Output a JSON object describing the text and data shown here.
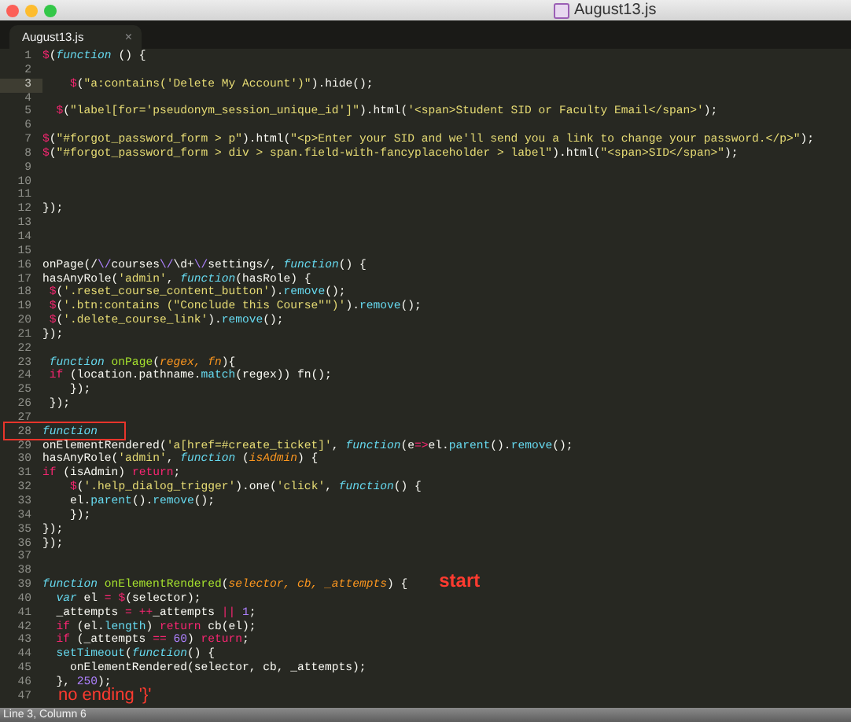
{
  "window": {
    "title": "August13.js"
  },
  "tabs": [
    {
      "label": "August13.js",
      "close": "×",
      "selected": true
    }
  ],
  "lines": [
    {
      "number": "1",
      "current": false,
      "tokens": [
        {
          "kind": "k",
          "text": "$"
        },
        {
          "kind": "t",
          "text": "("
        },
        {
          "kind": "f",
          "text": "function"
        },
        {
          "kind": "t",
          "text": " () {"
        }
      ]
    },
    {
      "number": "2",
      "current": false
    },
    {
      "number": "3",
      "current": true,
      "tokens": [
        {
          "kind": "k",
          "text": "    $"
        },
        {
          "kind": "t",
          "text": "("
        },
        {
          "kind": "s",
          "text": "\"a:contains('Delete My Account')\""
        },
        {
          "kind": "t",
          "text": ").hide();"
        }
      ]
    },
    {
      "number": "4",
      "current": false
    },
    {
      "number": "5",
      "current": false,
      "tokens": [
        {
          "kind": "k",
          "text": "  $"
        },
        {
          "kind": "t",
          "text": "("
        },
        {
          "kind": "s",
          "text": "\"label[for='pseudonym_session_unique_id']\""
        },
        {
          "kind": "t",
          "text": ").html("
        },
        {
          "kind": "s",
          "text": "'<span>Student SID or Faculty Email</span>'"
        },
        {
          "kind": "t",
          "text": ");"
        }
      ]
    },
    {
      "number": "6",
      "current": false
    },
    {
      "number": "7",
      "current": false,
      "tokens": [
        {
          "kind": "k",
          "text": "$"
        },
        {
          "kind": "t",
          "text": "("
        },
        {
          "kind": "s",
          "text": "\"#forgot_password_form > p\""
        },
        {
          "kind": "t",
          "text": ").html("
        },
        {
          "kind": "s",
          "text": "\"<p>Enter your SID and we'll send you a link to change your password.</p>\""
        },
        {
          "kind": "t",
          "text": ");"
        }
      ]
    },
    {
      "number": "8",
      "current": false,
      "tokens": [
        {
          "kind": "k",
          "text": "$"
        },
        {
          "kind": "t",
          "text": "("
        },
        {
          "kind": "s",
          "text": "\"#forgot_password_form > div > span.field-with-fancyplaceholder > label\""
        },
        {
          "kind": "t",
          "text": ").html("
        },
        {
          "kind": "s",
          "text": "\"<span>SID</span>\""
        },
        {
          "kind": "t",
          "text": ");"
        }
      ]
    },
    {
      "number": "9",
      "current": false
    },
    {
      "number": "10",
      "current": false
    },
    {
      "number": "11",
      "current": false
    },
    {
      "number": "12",
      "current": false,
      "tokens": [
        {
          "kind": "t",
          "text": "});"
        }
      ]
    },
    {
      "number": "13",
      "current": false
    },
    {
      "number": "14",
      "current": false
    },
    {
      "number": "15",
      "current": false
    },
    {
      "number": "16",
      "current": false,
      "tokens": [
        {
          "kind": "t",
          "text": "onPage(/"
        },
        {
          "kind": "n",
          "text": "\\/"
        },
        {
          "kind": "t",
          "text": "courses"
        },
        {
          "kind": "n",
          "text": "\\/"
        },
        {
          "kind": "t",
          "text": "\\d+"
        },
        {
          "kind": "n",
          "text": "\\/"
        },
        {
          "kind": "t",
          "text": "settings/, "
        },
        {
          "kind": "f",
          "text": "function"
        },
        {
          "kind": "t",
          "text": "() {"
        }
      ]
    },
    {
      "number": "17",
      "current": false,
      "tokens": [
        {
          "kind": "t",
          "text": "hasAnyRole("
        },
        {
          "kind": "s",
          "text": "'admin'"
        },
        {
          "kind": "t",
          "text": ", "
        },
        {
          "kind": "f",
          "text": "function"
        },
        {
          "kind": "t",
          "text": "(hasRole) {"
        }
      ]
    },
    {
      "number": "18",
      "current": false,
      "tokens": [
        {
          "kind": "k",
          "text": " $"
        },
        {
          "kind": "t",
          "text": "("
        },
        {
          "kind": "s",
          "text": "'.reset_course_content_button'"
        },
        {
          "kind": "t",
          "text": ")."
        },
        {
          "kind": "c",
          "text": "remove"
        },
        {
          "kind": "t",
          "text": "();"
        }
      ]
    },
    {
      "number": "19",
      "current": false,
      "tokens": [
        {
          "kind": "k",
          "text": " $"
        },
        {
          "kind": "t",
          "text": "("
        },
        {
          "kind": "s",
          "text": "'.btn:contains (\"Conclude this Course\"\")'"
        },
        {
          "kind": "t",
          "text": ")."
        },
        {
          "kind": "c",
          "text": "remove"
        },
        {
          "kind": "t",
          "text": "();"
        }
      ]
    },
    {
      "number": "20",
      "current": false,
      "tokens": [
        {
          "kind": "k",
          "text": " $"
        },
        {
          "kind": "t",
          "text": "("
        },
        {
          "kind": "s",
          "text": "'.delete_course_link'"
        },
        {
          "kind": "t",
          "text": ")."
        },
        {
          "kind": "c",
          "text": "remove"
        },
        {
          "kind": "t",
          "text": "();"
        }
      ]
    },
    {
      "number": "21",
      "current": false,
      "tokens": [
        {
          "kind": "t",
          "text": "});"
        }
      ]
    },
    {
      "number": "22",
      "current": false
    },
    {
      "number": "23",
      "current": false,
      "tokens": [
        {
          "kind": "f",
          "text": " function"
        },
        {
          "kind": "g",
          "text": " onPage"
        },
        {
          "kind": "t",
          "text": "("
        },
        {
          "kind": "p",
          "text": "regex, fn"
        },
        {
          "kind": "t",
          "text": "){"
        }
      ]
    },
    {
      "number": "24",
      "current": false,
      "tokens": [
        {
          "kind": "k",
          "text": " if"
        },
        {
          "kind": "t",
          "text": " (location.pathname."
        },
        {
          "kind": "c",
          "text": "match"
        },
        {
          "kind": "t",
          "text": "(regex)) fn();"
        }
      ]
    },
    {
      "number": "25",
      "current": false,
      "tokens": [
        {
          "kind": "t",
          "text": "    });"
        }
      ]
    },
    {
      "number": "26",
      "current": false,
      "tokens": [
        {
          "kind": "t",
          "text": " });"
        }
      ]
    },
    {
      "number": "27",
      "current": false
    },
    {
      "number": "28",
      "current": false,
      "boxed": true,
      "tokens": [
        {
          "kind": "f",
          "text": "function"
        }
      ]
    },
    {
      "number": "29",
      "current": false,
      "tokens": [
        {
          "kind": "t",
          "text": "onElementRendered("
        },
        {
          "kind": "s",
          "text": "'a[href=#create_ticket]'"
        },
        {
          "kind": "t",
          "text": ", "
        },
        {
          "kind": "f",
          "text": "function"
        },
        {
          "kind": "t",
          "text": "(e"
        },
        {
          "kind": "k",
          "text": "=>"
        },
        {
          "kind": "t",
          "text": "el."
        },
        {
          "kind": "c",
          "text": "parent"
        },
        {
          "kind": "t",
          "text": "()."
        },
        {
          "kind": "c",
          "text": "remove"
        },
        {
          "kind": "t",
          "text": "();"
        }
      ]
    },
    {
      "number": "30",
      "current": false,
      "tokens": [
        {
          "kind": "t",
          "text": "hasAnyRole("
        },
        {
          "kind": "s",
          "text": "'admin'"
        },
        {
          "kind": "t",
          "text": ", "
        },
        {
          "kind": "f",
          "text": "function"
        },
        {
          "kind": "t",
          "text": " ("
        },
        {
          "kind": "p",
          "text": "isAdmin"
        },
        {
          "kind": "t",
          "text": ") {"
        }
      ]
    },
    {
      "number": "31",
      "current": false,
      "tokens": [
        {
          "kind": "k",
          "text": "if"
        },
        {
          "kind": "t",
          "text": " (isAdmin) "
        },
        {
          "kind": "k",
          "text": "return"
        },
        {
          "kind": "t",
          "text": ";"
        }
      ]
    },
    {
      "number": "32",
      "current": false,
      "tokens": [
        {
          "kind": "k",
          "text": "    $"
        },
        {
          "kind": "t",
          "text": "("
        },
        {
          "kind": "s",
          "text": "'.help_dialog_trigger'"
        },
        {
          "kind": "t",
          "text": ").one("
        },
        {
          "kind": "s",
          "text": "'click'"
        },
        {
          "kind": "t",
          "text": ", "
        },
        {
          "kind": "f",
          "text": "function"
        },
        {
          "kind": "t",
          "text": "() {"
        }
      ]
    },
    {
      "number": "33",
      "current": false,
      "tokens": [
        {
          "kind": "t",
          "text": "    el."
        },
        {
          "kind": "c",
          "text": "parent"
        },
        {
          "kind": "t",
          "text": "()."
        },
        {
          "kind": "c",
          "text": "remove"
        },
        {
          "kind": "t",
          "text": "();"
        }
      ]
    },
    {
      "number": "34",
      "current": false,
      "tokens": [
        {
          "kind": "t",
          "text": "    });"
        }
      ]
    },
    {
      "number": "35",
      "current": false,
      "tokens": [
        {
          "kind": "t",
          "text": "});"
        }
      ]
    },
    {
      "number": "36",
      "current": false,
      "tokens": [
        {
          "kind": "t",
          "text": "});"
        }
      ]
    },
    {
      "number": "37",
      "current": false
    },
    {
      "number": "38",
      "current": false
    },
    {
      "number": "39",
      "current": false,
      "note": "start",
      "tokens": [
        {
          "kind": "f",
          "text": "function"
        },
        {
          "kind": "g",
          "text": " onElementRendered"
        },
        {
          "kind": "t",
          "text": "("
        },
        {
          "kind": "p",
          "text": "selector, cb, _attempts"
        },
        {
          "kind": "t",
          "text": ") {"
        }
      ]
    },
    {
      "number": "40",
      "current": false,
      "tokens": [
        {
          "kind": "f",
          "text": "  var"
        },
        {
          "kind": "t",
          "text": " el "
        },
        {
          "kind": "k",
          "text": "="
        },
        {
          "kind": "k",
          "text": " $"
        },
        {
          "kind": "t",
          "text": "(selector);"
        }
      ]
    },
    {
      "number": "41",
      "current": false,
      "tokens": [
        {
          "kind": "t",
          "text": "  _attempts "
        },
        {
          "kind": "k",
          "text": "="
        },
        {
          "kind": "k",
          "text": " ++"
        },
        {
          "kind": "t",
          "text": "_attempts "
        },
        {
          "kind": "k",
          "text": "||"
        },
        {
          "kind": "n",
          "text": " 1"
        },
        {
          "kind": "t",
          "text": ";"
        }
      ]
    },
    {
      "number": "42",
      "current": false,
      "tokens": [
        {
          "kind": "k",
          "text": "  if"
        },
        {
          "kind": "t",
          "text": " (el."
        },
        {
          "kind": "c",
          "text": "length"
        },
        {
          "kind": "t",
          "text": ") "
        },
        {
          "kind": "k",
          "text": "return"
        },
        {
          "kind": "t",
          "text": " cb(el);"
        }
      ]
    },
    {
      "number": "43",
      "current": false,
      "tokens": [
        {
          "kind": "k",
          "text": "  if"
        },
        {
          "kind": "t",
          "text": " (_attempts "
        },
        {
          "kind": "k",
          "text": "=="
        },
        {
          "kind": "n",
          "text": " 60"
        },
        {
          "kind": "t",
          "text": ") "
        },
        {
          "kind": "k",
          "text": "return"
        },
        {
          "kind": "t",
          "text": ";"
        }
      ]
    },
    {
      "number": "44",
      "current": false,
      "tokens": [
        {
          "kind": "c",
          "text": "  setTimeout"
        },
        {
          "kind": "t",
          "text": "("
        },
        {
          "kind": "f",
          "text": "function"
        },
        {
          "kind": "t",
          "text": "() {"
        }
      ]
    },
    {
      "number": "45",
      "current": false,
      "tokens": [
        {
          "kind": "t",
          "text": "    onElementRendered(selector, cb, _attempts);"
        }
      ]
    },
    {
      "number": "46",
      "current": false,
      "tokens": [
        {
          "kind": "t",
          "text": "  }, "
        },
        {
          "kind": "n",
          "text": "250"
        },
        {
          "kind": "t",
          "text": ");"
        }
      ]
    },
    {
      "number": "47",
      "current": false,
      "note": "no ending '}'"
    }
  ],
  "status_bar": "Line 3, Column 6"
}
